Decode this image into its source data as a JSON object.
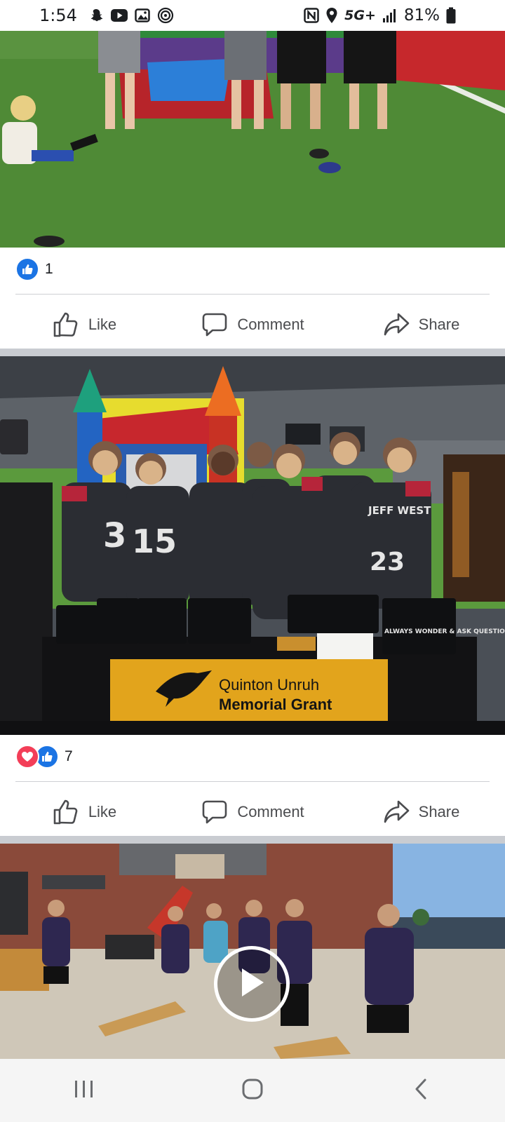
{
  "status_bar": {
    "time": "1:54",
    "network": "5G+",
    "battery": "81%",
    "left_icons": [
      "snapchat-icon",
      "youtube-icon",
      "gallery-icon",
      "nfc-ring-icon"
    ],
    "right_icons": [
      "nfc-icon",
      "location-icon",
      "signal-icon",
      "battery-icon"
    ]
  },
  "posts": [
    {
      "reaction_icons": [
        "like"
      ],
      "reaction_count": "1",
      "actions": {
        "like": "Like",
        "comment": "Comment",
        "share": "Share"
      }
    },
    {
      "reaction_icons": [
        "love",
        "like"
      ],
      "reaction_count": "7",
      "actions": {
        "like": "Like",
        "comment": "Comment",
        "share": "Share"
      },
      "banner": {
        "line1": "Quinton Unruh",
        "line2": "Memorial Grant"
      },
      "shirt_text": "ALWAYS WONDER & ASK QUESTIONS",
      "jersey_text": "JEFF WEST",
      "jersey_numbers": [
        "3",
        "15",
        "23"
      ]
    }
  ],
  "video": {
    "play_icon": "play-icon"
  },
  "nav_bar": {
    "buttons": [
      "recents-button",
      "home-button",
      "back-button"
    ]
  },
  "colors": {
    "facebook_blue": "#1b74e4",
    "love_red": "#f33e58",
    "action_gray": "#4b4c4f",
    "separator": "#c9ccd1",
    "banner_gold": "#e2a41c"
  }
}
